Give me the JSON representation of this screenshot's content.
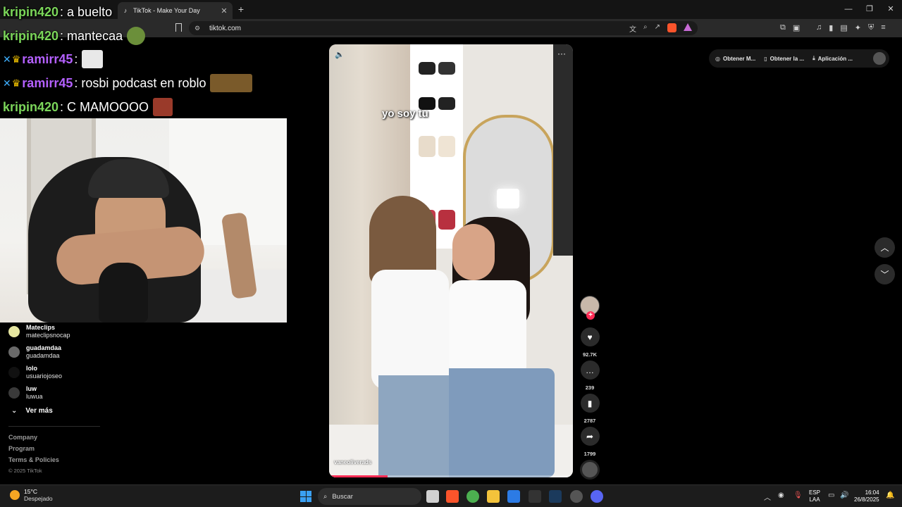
{
  "browser": {
    "tab_title": "TikTok - Make Your Day",
    "url": "tiktok.com"
  },
  "chat": [
    {
      "user": "kripin420",
      "message": ": a buelto"
    },
    {
      "user": "kripin420",
      "message": ": mantecaa"
    },
    {
      "user": "ramirr45",
      "message": ":"
    },
    {
      "user": "ramirr45",
      "message": ": rosbi podcast en roblo"
    },
    {
      "user": "kripin420",
      "message": ": C MAMOOOO"
    }
  ],
  "sidebar": {
    "accounts": [
      {
        "name": "Mateclips",
        "handle": "mateclipsnocap"
      },
      {
        "name": "guadamdaa",
        "handle": "guadamdaa"
      },
      {
        "name": "lolo",
        "handle": "usuariojoseo"
      },
      {
        "name": "luw",
        "handle": "luwua"
      }
    ],
    "see_more": "Ver más",
    "footer": [
      "Company",
      "Program",
      "Terms & Policies"
    ],
    "copyright": "© 2025 TikTok"
  },
  "video": {
    "caption": "yo soy tu",
    "handle": "vaneoliverads",
    "progress": 0.24,
    "likes": "92.7K",
    "comments": "239",
    "saves": "2787",
    "shares": "1799"
  },
  "top_pill": {
    "item1": "Obtener M...",
    "item2": "Obtener la ...",
    "item3": "Aplicación ..."
  },
  "taskbar": {
    "temp": "15°C",
    "weather": "Despejado",
    "search": "Buscar",
    "lang1": "ESP",
    "lang2": "LAA",
    "time": "16:04",
    "date": "26/8/2025"
  },
  "colors": {
    "tiktok_red": "#fe2c55",
    "chat_green": "#7bd65a",
    "chat_purple": "#b460ff"
  }
}
